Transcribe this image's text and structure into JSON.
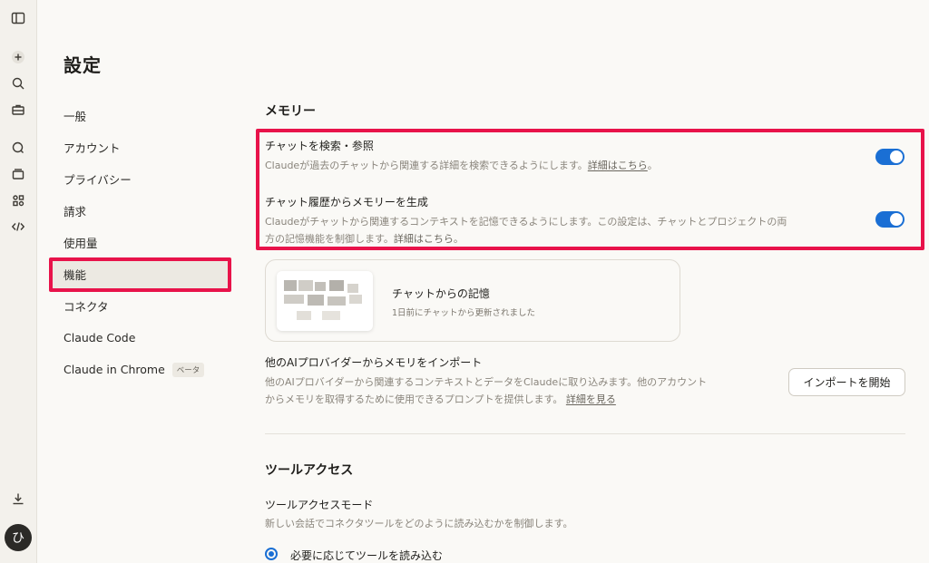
{
  "settings": {
    "title": "設定"
  },
  "nav": {
    "items": [
      {
        "label": "一般"
      },
      {
        "label": "アカウント"
      },
      {
        "label": "プライバシー"
      },
      {
        "label": "請求"
      },
      {
        "label": "使用量"
      },
      {
        "label": "機能"
      },
      {
        "label": "コネクタ"
      },
      {
        "label": "Claude Code"
      },
      {
        "label": "Claude in Chrome"
      }
    ],
    "beta_badge": "ベータ",
    "active_index": 5
  },
  "memory": {
    "title": "メモリー",
    "search_ref": {
      "title": "チャットを検索・参照",
      "desc": "Claudeが過去のチャットから関連する詳細を検索できるようにします。",
      "link": "詳細はこちら",
      "period": "。",
      "enabled": true
    },
    "history_gen": {
      "title": "チャット履歴からメモリーを生成",
      "desc_line1": "Claudeがチャットから関連するコンテキストを記憶できるようにします。この設定は、チャットとプロジェクトの両",
      "desc_line2": "方の記憶機能を制御します。",
      "link": "詳細はこちら",
      "period": "。",
      "enabled": true
    },
    "card": {
      "title": "チャットからの記憶",
      "subtitle": "1日前にチャットから更新されました"
    },
    "import": {
      "title": "他のAIプロバイダーからメモリをインポート",
      "desc_line1": "他のAIプロバイダーから関連するコンテキストとデータをClaudeに取り込みます。他のアカウント",
      "desc_line2": "からメモリを取得するために使用できるプロンプトを提供します。",
      "link": "詳細を見る",
      "button": "インポートを開始"
    }
  },
  "tool_access": {
    "title": "ツールアクセス",
    "mode_title": "ツールアクセスモード",
    "mode_desc": "新しい会話でコネクタツールをどのように読み込むかを制御します。",
    "option_selected": "必要に応じてツールを読み込む"
  },
  "user": {
    "avatar_initial": "ひ"
  },
  "colors": {
    "accent": "#1a6fd4",
    "highlight": "#e8134a"
  }
}
